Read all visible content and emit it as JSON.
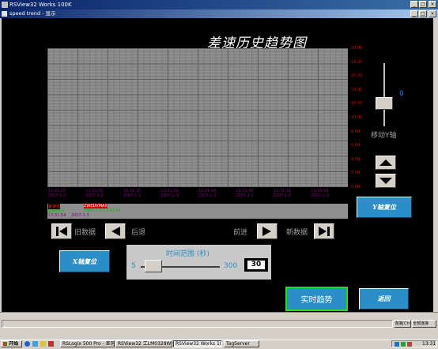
{
  "outer_window": {
    "title": "RSView32 Works 100K"
  },
  "inner_window": {
    "title": "speed trend - 显示"
  },
  "trend": {
    "title": "差速历史趋势图",
    "y_labels": [
      "20.00",
      "18.00",
      "16.00",
      "14.00",
      "12.00",
      "10.00",
      "8.00",
      "6.00",
      "4.00",
      "2.00",
      "0.00"
    ],
    "x_labels": [
      {
        "time": "13:31:25",
        "date": "2007-1-3"
      },
      {
        "time": "13:31:30",
        "date": "2007-1-3"
      },
      {
        "time": "13:31:35",
        "date": "2007-1-3"
      },
      {
        "time": "13:31:39",
        "date": "2007-1-3"
      },
      {
        "time": "13:31:44",
        "date": "2007-1-3"
      },
      {
        "time": "13:31:45",
        "date": "2007-1-3"
      },
      {
        "time": "13:31:51",
        "date": "2007-1-3"
      },
      {
        "time": "13:31:54",
        "date": "2007-1-3"
      }
    ],
    "legend": {
      "row1_left": "差速值",
      "row1_right": "ZWEDVMAX",
      "row2_left": "差速时间",
      "row2_right": "2007-1-3 13:31:54",
      "row3_left": "13:31:54",
      "row3_right": "2007-1-3"
    }
  },
  "y_axis_control": {
    "value": "0",
    "label": "移动Y轴"
  },
  "buttons": {
    "y_reset": "Y轴复位",
    "x_reset": "X轴复位",
    "realtime": "实时趋势",
    "back": "返回"
  },
  "navigation": {
    "old_data": "旧数据",
    "back": "后退",
    "forward": "前进",
    "new_data": "新数据"
  },
  "time_range": {
    "title": "时间范围 (秒)",
    "min": "5",
    "max": "300",
    "value": "30"
  },
  "status": {
    "btn1": "连接[Ctrl]",
    "btn2": "全部连接"
  },
  "taskbar": {
    "start": "开始",
    "tasks": [
      "RSLogix 500 Pro - 差钩程...",
      "RSView32 工LM0328W需...",
      "RSView32 Works 100K",
      "TagServer"
    ],
    "clock": "13:31"
  }
}
